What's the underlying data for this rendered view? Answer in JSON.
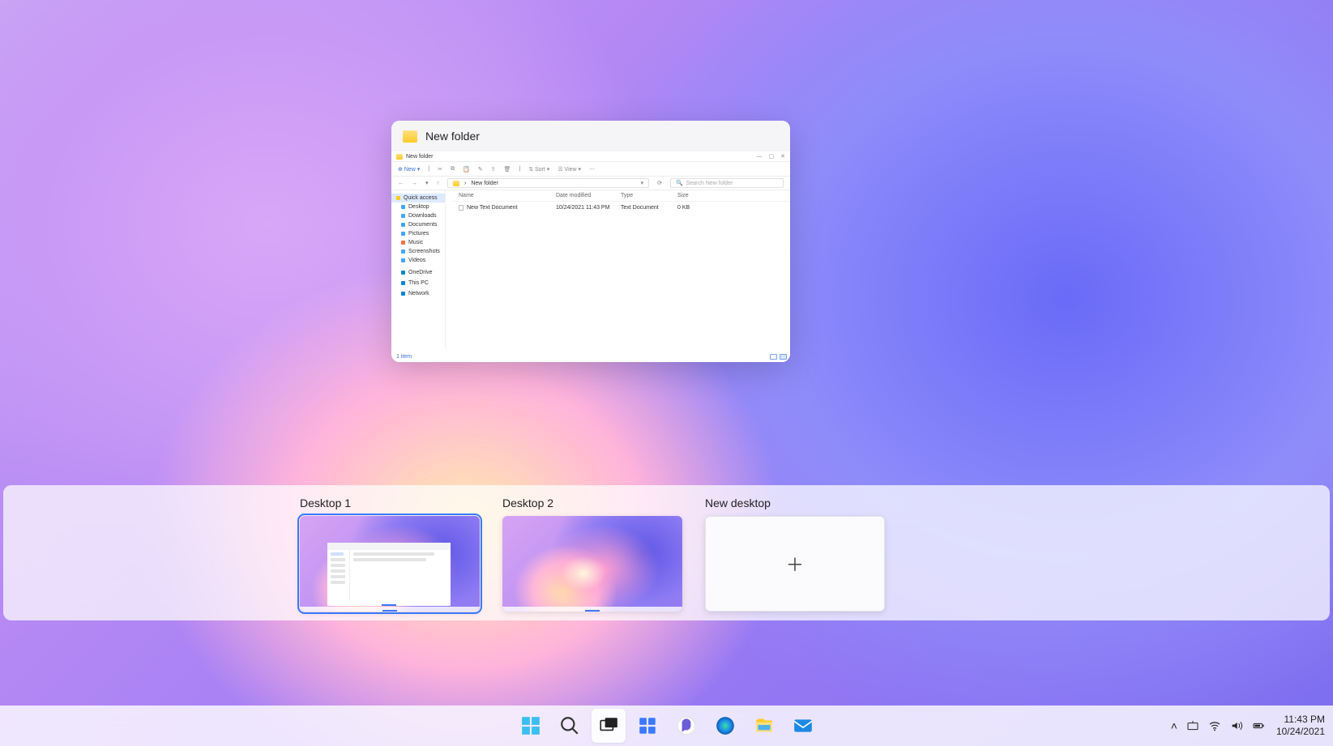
{
  "taskview": {
    "window": {
      "caption": "New folder",
      "tab_title": "New folder",
      "toolbar": {
        "new": "New",
        "sort": "Sort",
        "view": "View"
      },
      "path": "New folder",
      "search_placeholder": "Search New folder",
      "sidebar": {
        "quick_access": "Quick access",
        "items": [
          "Desktop",
          "Downloads",
          "Documents",
          "Pictures",
          "Music",
          "Screenshots",
          "Videos"
        ],
        "onedrive": "OneDrive",
        "thispc": "This PC",
        "network": "Network"
      },
      "columns": {
        "name": "Name",
        "date": "Date modified",
        "type": "Type",
        "size": "Size"
      },
      "row": {
        "name": "New Text Document",
        "date": "10/24/2021 11:43 PM",
        "type": "Text Document",
        "size": "0 KB"
      },
      "status": "1 item"
    }
  },
  "desktops": {
    "items": [
      {
        "label": "Desktop 1"
      },
      {
        "label": "Desktop 2"
      }
    ],
    "new_label": "New desktop"
  },
  "taskbar": {
    "time": "11:43 PM",
    "date": "10/24/2021"
  }
}
